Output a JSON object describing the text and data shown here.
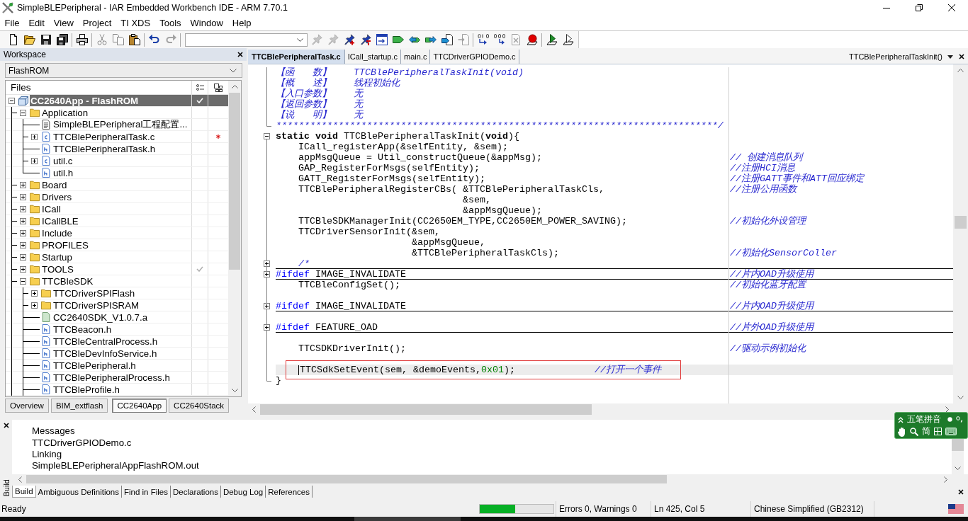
{
  "window": {
    "title": "SimpleBLEPeripheral - IAR Embedded Workbench IDE - ARM 7.70.1"
  },
  "menu": [
    "File",
    "Edit",
    "View",
    "Project",
    "TI XDS",
    "Tools",
    "Window",
    "Help"
  ],
  "toolbar": [
    {
      "kind": "button",
      "disabled": false
    },
    {
      "kind": "button",
      "disabled": false
    },
    {
      "kind": "button",
      "disabled": false
    },
    {
      "kind": "button",
      "disabled": false
    },
    {
      "kind": "separator"
    },
    {
      "kind": "button",
      "disabled": false
    },
    {
      "kind": "separator"
    },
    {
      "kind": "button",
      "disabled": true
    },
    {
      "kind": "button",
      "disabled": true
    },
    {
      "kind": "button",
      "disabled": false
    },
    {
      "kind": "separator"
    },
    {
      "kind": "button",
      "disabled": false
    },
    {
      "kind": "button",
      "disabled": true
    },
    {
      "kind": "separator"
    },
    {
      "kind": "combo"
    },
    {
      "kind": "button",
      "disabled": true
    },
    {
      "kind": "button",
      "disabled": true
    },
    {
      "kind": "button",
      "disabled": false
    },
    {
      "kind": "button",
      "disabled": false
    },
    {
      "kind": "button",
      "disabled": false
    },
    {
      "kind": "button",
      "disabled": false
    },
    {
      "kind": "button",
      "disabled": false
    },
    {
      "kind": "button",
      "disabled": false
    },
    {
      "kind": "button",
      "disabled": false
    },
    {
      "kind": "button",
      "disabled": true
    },
    {
      "kind": "separator"
    },
    {
      "kind": "button",
      "disabled": false
    },
    {
      "kind": "button",
      "disabled": false
    },
    {
      "kind": "button",
      "disabled": true
    },
    {
      "kind": "button",
      "disabled": false
    },
    {
      "kind": "separator"
    },
    {
      "kind": "button",
      "disabled": false
    },
    {
      "kind": "button",
      "disabled": false
    }
  ],
  "workspace": {
    "title": "Workspace",
    "configuration": "FlashROM",
    "column": "Files",
    "more_below": true,
    "tree": [
      {
        "label": "CC2640App - FlashROM",
        "kind": "project",
        "selected": true,
        "expanded": true,
        "check": true,
        "out_of_date": false,
        "children": [
          {
            "label": "Application",
            "kind": "folder",
            "selected": false,
            "expanded": true,
            "check": false,
            "out_of_date": false,
            "children": [
              {
                "label": "SimpleBLEPeripheral工程配置...",
                "kind": "document",
                "selected": false,
                "check": false,
                "out_of_date": false
              },
              {
                "label": "TTCBlePeripheralTask.c",
                "kind": "source",
                "selected": false,
                "expanded": false,
                "check": false,
                "out_of_date": true
              },
              {
                "label": "TTCBlePeripheralTask.h",
                "kind": "header",
                "selected": false,
                "check": false,
                "out_of_date": false
              },
              {
                "label": "util.c",
                "kind": "source",
                "selected": false,
                "expanded": false,
                "check": false,
                "out_of_date": false
              },
              {
                "label": "util.h",
                "kind": "header",
                "selected": false,
                "check": false,
                "out_of_date": false
              }
            ]
          },
          {
            "label": "Board",
            "kind": "folder",
            "selected": false,
            "expanded": false,
            "check": false,
            "out_of_date": false
          },
          {
            "label": "Drivers",
            "kind": "folder",
            "selected": false,
            "expanded": false,
            "check": false,
            "out_of_date": false
          },
          {
            "label": "ICall",
            "kind": "folder",
            "selected": false,
            "expanded": false,
            "check": false,
            "out_of_date": false
          },
          {
            "label": "ICallBLE",
            "kind": "folder",
            "selected": false,
            "expanded": false,
            "check": false,
            "out_of_date": false
          },
          {
            "label": "Include",
            "kind": "folder",
            "selected": false,
            "expanded": false,
            "check": false,
            "out_of_date": false
          },
          {
            "label": "PROFILES",
            "kind": "folder",
            "selected": false,
            "expanded": false,
            "check": false,
            "out_of_date": false
          },
          {
            "label": "Startup",
            "kind": "folder",
            "selected": false,
            "expanded": false,
            "check": false,
            "out_of_date": false
          },
          {
            "label": "TOOLS",
            "kind": "folder",
            "selected": false,
            "expanded": false,
            "check": true,
            "out_of_date": false
          },
          {
            "label": "TTCBleSDK",
            "kind": "folder",
            "selected": false,
            "expanded": true,
            "check": false,
            "out_of_date": false,
            "children": [
              {
                "label": "TTCDriverSPIFlash",
                "kind": "folder",
                "selected": false,
                "expanded": false,
                "check": false,
                "out_of_date": false
              },
              {
                "label": "TTCDriverSPISRAM",
                "kind": "folder",
                "selected": false,
                "expanded": false,
                "check": false,
                "out_of_date": false
              },
              {
                "label": "CC2640SDK_V1.0.7.a",
                "kind": "library",
                "selected": false,
                "check": false,
                "out_of_date": false
              },
              {
                "label": "TTCBeacon.h",
                "kind": "header",
                "selected": false,
                "check": false,
                "out_of_date": false
              },
              {
                "label": "TTCBleCentralProcess.h",
                "kind": "header",
                "selected": false,
                "check": false,
                "out_of_date": false
              },
              {
                "label": "TTCBleDevInfoService.h",
                "kind": "header",
                "selected": false,
                "check": false,
                "out_of_date": false
              },
              {
                "label": "TTCBlePeripheral.h",
                "kind": "header",
                "selected": false,
                "check": false,
                "out_of_date": false
              },
              {
                "label": "TTCBlePeripheralProcess.h",
                "kind": "header",
                "selected": false,
                "check": false,
                "out_of_date": false
              },
              {
                "label": "TTCBleProfile.h",
                "kind": "header",
                "selected": false,
                "check": false,
                "out_of_date": false
              }
            ]
          }
        ]
      }
    ],
    "tabs": [
      {
        "label": "Overview",
        "selected": false
      },
      {
        "label": "BIM_extflash",
        "selected": false
      },
      {
        "label": "CC2640App",
        "selected": true
      },
      {
        "label": "CC2640Stack",
        "selected": false
      }
    ]
  },
  "editor": {
    "tabs": [
      {
        "label": "TTCBlePeripheralTask.c",
        "selected": true
      },
      {
        "label": "ICall_startup.c",
        "selected": false
      },
      {
        "label": "main.c",
        "selected": false
      },
      {
        "label": "TTCDriverGPIODemo.c",
        "selected": false
      }
    ],
    "function_name": "TTCBlePeripheralTaskInit()",
    "lines": [
      {
        "kind": "line",
        "segments": [
          {
            "text": "【函　　数】    TTCBlePeripheralTaskInit(void)",
            "kind": "comment"
          }
        ],
        "current": false,
        "framed": false
      },
      {
        "kind": "line",
        "segments": [
          {
            "text": "【概　　述】    线程初始化",
            "kind": "comment"
          }
        ],
        "current": false,
        "framed": false
      },
      {
        "kind": "line",
        "segments": [
          {
            "text": "【入口参数】    无",
            "kind": "comment"
          }
        ],
        "current": false,
        "framed": false
      },
      {
        "kind": "line",
        "segments": [
          {
            "text": "【返回参数】    无",
            "kind": "comment"
          }
        ],
        "current": false,
        "framed": false
      },
      {
        "kind": "line",
        "segments": [
          {
            "text": "【说　　明】    无",
            "kind": "comment"
          }
        ],
        "current": false,
        "framed": false
      },
      {
        "kind": "end",
        "segments": [
          {
            "text": "******************************************************************************/",
            "kind": "comment"
          }
        ],
        "current": false,
        "framed": false
      },
      {
        "kind": "open",
        "segments": [
          {
            "text": "static void",
            "kind": "keyword"
          },
          {
            "text": " TTCBlePeripheralTaskInit(",
            "kind": "text"
          },
          {
            "text": "void",
            "kind": "keyword"
          },
          {
            "text": "){",
            "kind": "text"
          }
        ],
        "current": false,
        "framed": false
      },
      {
        "kind": "line",
        "segments": [
          {
            "text": "    ICall_registerApp(&selfEntity, &sem);",
            "kind": "text"
          }
        ],
        "current": false,
        "framed": false
      },
      {
        "kind": "line",
        "segments": [
          {
            "text": "    appMsgQueue = Util_constructQueue(&appMsg);",
            "kind": "text"
          }
        ],
        "comment": "// 创建消息队列",
        "current": false,
        "framed": false
      },
      {
        "kind": "line",
        "segments": [
          {
            "text": "    GAP_RegisterForMsgs(selfEntity);",
            "kind": "text"
          }
        ],
        "comment": "//注册HCI消息",
        "current": false,
        "framed": false
      },
      {
        "kind": "line",
        "segments": [
          {
            "text": "    GATT_RegisterForMsgs(selfEntity);",
            "kind": "text"
          }
        ],
        "comment": "//注册GATT事件和ATT回应绑定",
        "current": false,
        "framed": false
      },
      {
        "kind": "line",
        "segments": [
          {
            "text": "    TTCBlePeripheralRegisterCBs( &TTCBlePeripheralTaskCls,",
            "kind": "text"
          }
        ],
        "comment": "//注册公用函数",
        "current": false,
        "framed": false
      },
      {
        "kind": "line",
        "segments": [
          {
            "text": "                                 &sem,",
            "kind": "text"
          }
        ],
        "current": false,
        "framed": false
      },
      {
        "kind": "line",
        "segments": [
          {
            "text": "                                 &appMsgQueue);",
            "kind": "text"
          }
        ],
        "current": false,
        "framed": false
      },
      {
        "kind": "line",
        "segments": [
          {
            "text": "    TTCBleSDKManagerInit(CC2650EM_TYPE,CC2650EM_POWER_SAVING);",
            "kind": "text"
          }
        ],
        "comment": "//初始化外设管理",
        "current": false,
        "framed": false
      },
      {
        "kind": "line",
        "segments": [
          {
            "text": "    TTCDriverSensorInit(&sem,",
            "kind": "text"
          }
        ],
        "current": false,
        "framed": false
      },
      {
        "kind": "line",
        "segments": [
          {
            "text": "                        &appMsgQueue,",
            "kind": "text"
          }
        ],
        "current": false,
        "framed": false
      },
      {
        "kind": "line",
        "segments": [
          {
            "text": "                        &TTCBlePeripheralTaskCls);",
            "kind": "text"
          }
        ],
        "comment": "//初始化SensorColler",
        "current": false,
        "framed": false
      },
      {
        "kind": "closed",
        "segments": [
          {
            "text": "    /*",
            "kind": "comment"
          }
        ],
        "current": false,
        "framed": false
      },
      {
        "kind": "closed",
        "segments": [
          {
            "text": "#ifdef",
            "kind": "directive"
          },
          {
            "text": " IMAGE_INVALIDATE",
            "kind": "text"
          }
        ],
        "comment": "//片内OAD升级使用",
        "current": false,
        "framed": false
      },
      {
        "kind": "line",
        "segments": [
          {
            "text": "    TTCBleConfigSet();",
            "kind": "text"
          }
        ],
        "comment": "//初始化蓝牙配置",
        "current": false,
        "framed": false
      },
      {
        "kind": "line",
        "current": false,
        "framed": false
      },
      {
        "kind": "closed",
        "segments": [
          {
            "text": "#ifdef",
            "kind": "directive"
          },
          {
            "text": " IMAGE_INVALIDATE",
            "kind": "text"
          }
        ],
        "comment": "//片内OAD升级使用",
        "current": false,
        "framed": false
      },
      {
        "kind": "line",
        "current": false,
        "framed": false
      },
      {
        "kind": "closed",
        "segments": [
          {
            "text": "#ifdef",
            "kind": "directive"
          },
          {
            "text": " FEATURE_OAD",
            "kind": "text"
          }
        ],
        "comment": "//片外OAD升级使用",
        "current": false,
        "framed": false
      },
      {
        "kind": "line",
        "current": false,
        "framed": false
      },
      {
        "kind": "line",
        "segments": [
          {
            "text": "    TTCSDKDriverInit();",
            "kind": "text"
          }
        ],
        "comment": "//驱动示例初始化",
        "current": false,
        "framed": false
      },
      {
        "kind": "line",
        "current": false,
        "framed": false
      },
      {
        "kind": "line",
        "segments": [
          {
            "text": "    TTCSdkSetEvent(sem, &demoEvents,",
            "kind": "text"
          },
          {
            "text": "0x01",
            "kind": "number"
          },
          {
            "text": ");",
            "kind": "text"
          },
          {
            "text": "              //打开一个事件",
            "kind": "comment"
          }
        ],
        "current": true,
        "framed": true
      },
      {
        "kind": "end",
        "segments": [
          {
            "text": "}",
            "kind": "text"
          }
        ],
        "current": false,
        "framed": false
      }
    ]
  },
  "ime": {
    "mode": "五笔拼音",
    "charset": "简"
  },
  "output": {
    "side_label": "Build",
    "column": "Messages",
    "lines": [
      "TTCDriverGPIODemo.c",
      "Linking",
      "SimpleBLEPeripheralAppFlashROM.out"
    ],
    "tabs": [
      {
        "label": "Build",
        "selected": true
      },
      {
        "label": "Ambiguous Definitions",
        "selected": false
      },
      {
        "label": "Find in Files",
        "selected": false
      },
      {
        "label": "Declarations",
        "selected": false
      },
      {
        "label": "Debug Log",
        "selected": false
      },
      {
        "label": "References",
        "selected": false
      }
    ]
  },
  "status_bar": {
    "text": "Ready",
    "progress": {
      "level": 0.48
    },
    "errors": "Errors 0, Warnings 0",
    "position": "Ln 425, Col 5",
    "encoding": "Chinese Simplified (GB2312)"
  }
}
